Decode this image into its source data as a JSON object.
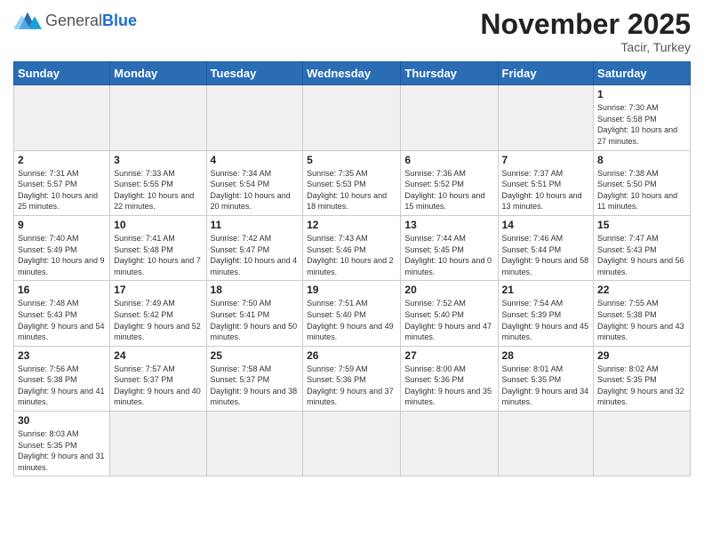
{
  "header": {
    "logo_general": "General",
    "logo_blue": "Blue",
    "month_title": "November 2025",
    "location": "Tacir, Turkey"
  },
  "weekdays": [
    "Sunday",
    "Monday",
    "Tuesday",
    "Wednesday",
    "Thursday",
    "Friday",
    "Saturday"
  ],
  "days": [
    {
      "num": "",
      "info": "",
      "empty": true
    },
    {
      "num": "",
      "info": "",
      "empty": true
    },
    {
      "num": "",
      "info": "",
      "empty": true
    },
    {
      "num": "",
      "info": "",
      "empty": true
    },
    {
      "num": "",
      "info": "",
      "empty": true
    },
    {
      "num": "",
      "info": "",
      "empty": true
    },
    {
      "num": "1",
      "info": "Sunrise: 7:30 AM\nSunset: 5:58 PM\nDaylight: 10 hours and 27 minutes."
    },
    {
      "num": "2",
      "info": "Sunrise: 7:31 AM\nSunset: 5:57 PM\nDaylight: 10 hours and 25 minutes."
    },
    {
      "num": "3",
      "info": "Sunrise: 7:33 AM\nSunset: 5:55 PM\nDaylight: 10 hours and 22 minutes."
    },
    {
      "num": "4",
      "info": "Sunrise: 7:34 AM\nSunset: 5:54 PM\nDaylight: 10 hours and 20 minutes."
    },
    {
      "num": "5",
      "info": "Sunrise: 7:35 AM\nSunset: 5:53 PM\nDaylight: 10 hours and 18 minutes."
    },
    {
      "num": "6",
      "info": "Sunrise: 7:36 AM\nSunset: 5:52 PM\nDaylight: 10 hours and 15 minutes."
    },
    {
      "num": "7",
      "info": "Sunrise: 7:37 AM\nSunset: 5:51 PM\nDaylight: 10 hours and 13 minutes."
    },
    {
      "num": "8",
      "info": "Sunrise: 7:38 AM\nSunset: 5:50 PM\nDaylight: 10 hours and 11 minutes."
    },
    {
      "num": "9",
      "info": "Sunrise: 7:40 AM\nSunset: 5:49 PM\nDaylight: 10 hours and 9 minutes."
    },
    {
      "num": "10",
      "info": "Sunrise: 7:41 AM\nSunset: 5:48 PM\nDaylight: 10 hours and 7 minutes."
    },
    {
      "num": "11",
      "info": "Sunrise: 7:42 AM\nSunset: 5:47 PM\nDaylight: 10 hours and 4 minutes."
    },
    {
      "num": "12",
      "info": "Sunrise: 7:43 AM\nSunset: 5:46 PM\nDaylight: 10 hours and 2 minutes."
    },
    {
      "num": "13",
      "info": "Sunrise: 7:44 AM\nSunset: 5:45 PM\nDaylight: 10 hours and 0 minutes."
    },
    {
      "num": "14",
      "info": "Sunrise: 7:46 AM\nSunset: 5:44 PM\nDaylight: 9 hours and 58 minutes."
    },
    {
      "num": "15",
      "info": "Sunrise: 7:47 AM\nSunset: 5:43 PM\nDaylight: 9 hours and 56 minutes."
    },
    {
      "num": "16",
      "info": "Sunrise: 7:48 AM\nSunset: 5:43 PM\nDaylight: 9 hours and 54 minutes."
    },
    {
      "num": "17",
      "info": "Sunrise: 7:49 AM\nSunset: 5:42 PM\nDaylight: 9 hours and 52 minutes."
    },
    {
      "num": "18",
      "info": "Sunrise: 7:50 AM\nSunset: 5:41 PM\nDaylight: 9 hours and 50 minutes."
    },
    {
      "num": "19",
      "info": "Sunrise: 7:51 AM\nSunset: 5:40 PM\nDaylight: 9 hours and 49 minutes."
    },
    {
      "num": "20",
      "info": "Sunrise: 7:52 AM\nSunset: 5:40 PM\nDaylight: 9 hours and 47 minutes."
    },
    {
      "num": "21",
      "info": "Sunrise: 7:54 AM\nSunset: 5:39 PM\nDaylight: 9 hours and 45 minutes."
    },
    {
      "num": "22",
      "info": "Sunrise: 7:55 AM\nSunset: 5:38 PM\nDaylight: 9 hours and 43 minutes."
    },
    {
      "num": "23",
      "info": "Sunrise: 7:56 AM\nSunset: 5:38 PM\nDaylight: 9 hours and 41 minutes."
    },
    {
      "num": "24",
      "info": "Sunrise: 7:57 AM\nSunset: 5:37 PM\nDaylight: 9 hours and 40 minutes."
    },
    {
      "num": "25",
      "info": "Sunrise: 7:58 AM\nSunset: 5:37 PM\nDaylight: 9 hours and 38 minutes."
    },
    {
      "num": "26",
      "info": "Sunrise: 7:59 AM\nSunset: 5:36 PM\nDaylight: 9 hours and 37 minutes."
    },
    {
      "num": "27",
      "info": "Sunrise: 8:00 AM\nSunset: 5:36 PM\nDaylight: 9 hours and 35 minutes."
    },
    {
      "num": "28",
      "info": "Sunrise: 8:01 AM\nSunset: 5:35 PM\nDaylight: 9 hours and 34 minutes."
    },
    {
      "num": "29",
      "info": "Sunrise: 8:02 AM\nSunset: 5:35 PM\nDaylight: 9 hours and 32 minutes."
    },
    {
      "num": "30",
      "info": "Sunrise: 8:03 AM\nSunset: 5:35 PM\nDaylight: 9 hours and 31 minutes."
    },
    {
      "num": "",
      "info": "",
      "empty": true
    },
    {
      "num": "",
      "info": "",
      "empty": true
    },
    {
      "num": "",
      "info": "",
      "empty": true
    },
    {
      "num": "",
      "info": "",
      "empty": true
    },
    {
      "num": "",
      "info": "",
      "empty": true
    },
    {
      "num": "",
      "info": "",
      "empty": true
    }
  ]
}
